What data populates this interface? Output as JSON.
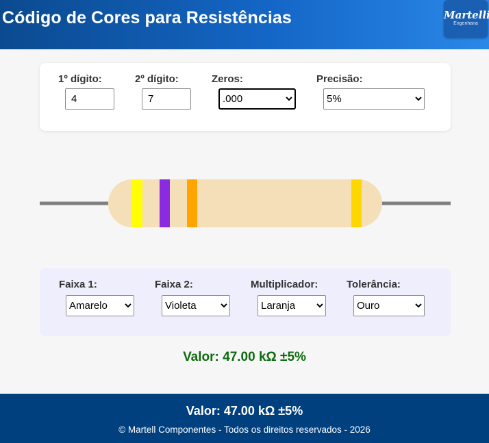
{
  "header": {
    "title": "Código de Cores para Resistências",
    "logo": {
      "main": "Martelli",
      "sub": "Engenharia"
    }
  },
  "inputs": {
    "digit1": {
      "label": "1º dígito:",
      "value": "4"
    },
    "digit2": {
      "label": "2º dígito:",
      "value": "7"
    },
    "zeros": {
      "label": "Zeros:",
      "selected": ".000"
    },
    "precision": {
      "label": "Precisão:",
      "selected": "5%"
    }
  },
  "resistor": {
    "body_color": "#f5dfb8",
    "lead_color": "#808080",
    "bands": [
      {
        "name": "Amarelo",
        "color": "#ffff00"
      },
      {
        "name": "Violeta",
        "color": "#8a2be2"
      },
      {
        "name": "Laranja",
        "color": "#ffa500"
      },
      {
        "name": "Ouro",
        "color": "#ffd700"
      }
    ]
  },
  "bands": {
    "band1": {
      "label": "Faixa 1:",
      "selected": "Amarelo"
    },
    "band2": {
      "label": "Faixa 2:",
      "selected": "Violeta"
    },
    "multiplier": {
      "label": "Multiplicador:",
      "selected": "Laranja"
    },
    "tolerance": {
      "label": "Tolerância:",
      "selected": "Ouro"
    }
  },
  "result": {
    "text": "Valor: 47.00 kΩ ±5%",
    "color": "#0e6b0e"
  },
  "footer": {
    "value": "Valor: 47.00 kΩ ±5%",
    "copyright": "© Martell Componentes - Todos os direitos reservados - 2026",
    "background": "#00407f"
  }
}
